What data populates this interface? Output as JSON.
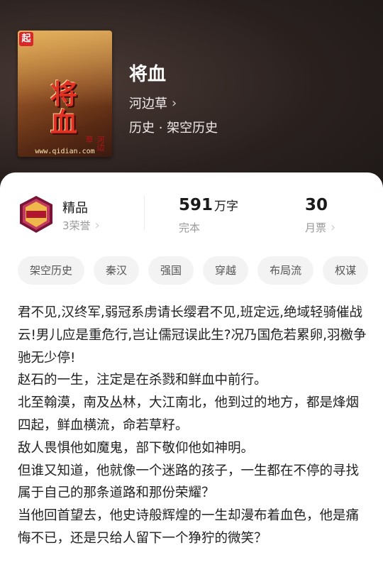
{
  "book": {
    "title": "将血",
    "author": "河边草",
    "genre": "历史 · 架空历史",
    "cover": {
      "logo": "起",
      "title": "将血",
      "author": "河边草",
      "url": "www.qidian.com"
    }
  },
  "stats": {
    "quality": {
      "label": "精品",
      "sub": "3荣誉"
    },
    "words": {
      "value": "591",
      "unit": "万字",
      "label": "完本"
    },
    "tickets": {
      "value": "30",
      "label": "月票"
    }
  },
  "tags": [
    "架空历史",
    "秦汉",
    "强国",
    "穿越",
    "布局流",
    "权谋"
  ],
  "synopsis": [
    "君不见,汉终军,弱冠系虏请长缨君不见,班定远,绝域轻骑催战云!男儿应是重危行,岂让儒冠误此生?况乃国危若累卵,羽檄争驰无少停!",
    "赵石的一生，注定是在杀戮和鲜血中前行。",
    "北至翰漠，南及丛林，大江南北，他到过的地方，都是烽烟四起，鲜血横流，命若草籽。",
    "敌人畏惧他如魔鬼，部下敬仰他如神明。",
    "但谁又知道，他就像一个迷路的孩子，一生都在不停的寻找属于自己的那条道路和那份荣耀？",
    "当他回首望去，他史诗般辉煌的一生却漫布着血色，他是痛悔不已，还是只给人留下一个狰狞的微笑？"
  ],
  "colors": {
    "header_bg": "#2a211f",
    "accent_red": "#d8262a",
    "muted": "#9a9a9a"
  }
}
